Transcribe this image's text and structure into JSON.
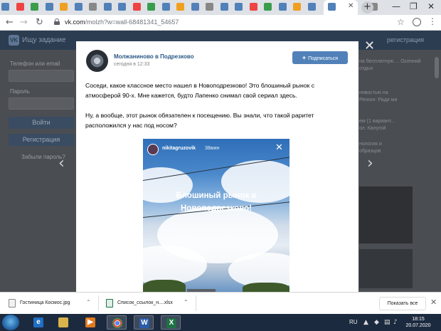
{
  "browser": {
    "url_host": "vk.com",
    "url_path": "/molzh?w=wall-68481341_54657",
    "win_minimize": "—",
    "win_maximize": "❐",
    "new_tab": "+",
    "back": "←",
    "forward": "→",
    "reload": "↻",
    "star": "☆",
    "menu": "⋮"
  },
  "vk_background": {
    "logo": "VK",
    "logo_text": "Ищу задание",
    "register": "регистрация",
    "phone_label": "Телефон или email",
    "password_label": "Пароль",
    "login_button": "Войти",
    "register_button": "Регистрация",
    "forgot": "Забыли пароль?",
    "right_notes": [
      "на бесплатную ... Осенний",
      "отдых",
      "новостью на",
      "Регион: Ради ми",
      "ем (1 вариант...",
      "ол. Калугой",
      "нология и",
      "образцов"
    ]
  },
  "post": {
    "group_name": "Молжаниново в Подрезково",
    "date": "сегодня в 12:33",
    "subscribe": "Подписаться",
    "text_p1_l1": "Соседи, какое классное место нашел в Новоподрезково! Это блошиный рынок с",
    "text_p1_l2": "атмосферой 90-х. Мне кажется, будто Лапенко снимал свой сериал здесь.",
    "text_p2_l1": "Ну, а вообще, этот рынок обязателен к посещению. Вы знали, что такой раритет",
    "text_p2_l2": "расположился у нас под носом?",
    "story": {
      "user": "nikitagruzovik",
      "time": "38мин",
      "close": "✕",
      "caption_l1": "Блошиный рынок в",
      "caption_l2": "Новоподрезково!"
    }
  },
  "nav": {
    "prev_arrow": "‹",
    "next_arrow": "›",
    "close": "✕"
  },
  "downloads": {
    "items": [
      {
        "name": "Гостиница Космос.jpg"
      },
      {
        "name": "Список_ссылок_н....xlsx"
      }
    ],
    "caret": "⌃",
    "show_all": "Показать все",
    "close": "✕"
  },
  "taskbar": {
    "lang": "RU",
    "time": "18:15",
    "date": "20.07.2020"
  }
}
